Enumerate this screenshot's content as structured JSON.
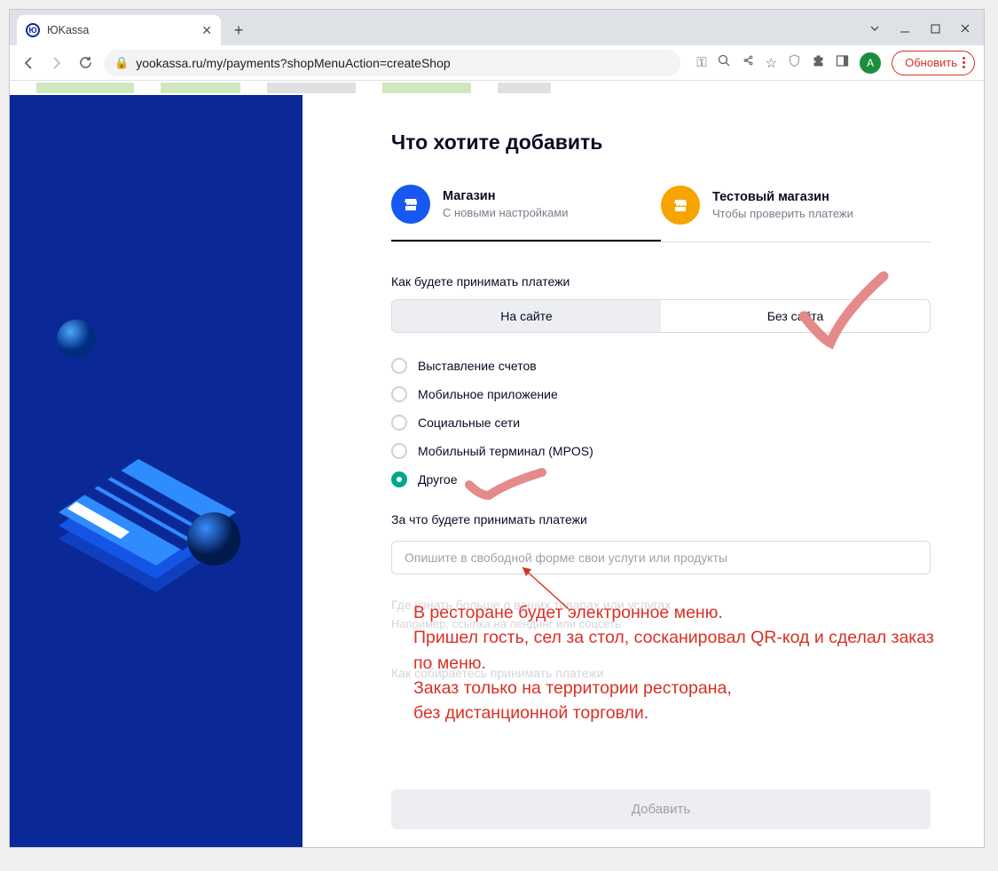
{
  "browser": {
    "tab_title": "ЮKassa",
    "url": "yookassa.ru/my/payments?shopMenuAction=createShop",
    "avatar_letter": "A",
    "update_label": "Обновить"
  },
  "page": {
    "heading": "Что хотите добавить",
    "type_tabs": [
      {
        "title": "Магазин",
        "sub": "С новыми настройками"
      },
      {
        "title": "Тестовый магазин",
        "sub": "Чтобы проверить платежи"
      }
    ],
    "how_label": "Как будете принимать платежи",
    "toggle": [
      "На сайте",
      "Без сайта"
    ],
    "radios": [
      "Выставление счетов",
      "Мобильное приложение",
      "Социальные сети",
      "Мобильный терминал (MPOS)",
      "Другое"
    ],
    "selected_radio": 4,
    "for_label": "За что будете принимать платежи",
    "for_placeholder": "Опишите в свободной форме свои услуги или продукты",
    "ghost1": "Где узнать больше о ваших товарах или услугах",
    "ghost2": "Например, ссылка на лендинг или соцсеть",
    "ghost3": "Как собираетесь принимать платежи",
    "submit": "Добавить"
  },
  "annotation": {
    "text": "В ресторане будет электронное меню.\nПришел гость, сел за стол, сосканировал QR-код и сделал заказ по меню.\nЗаказ только на территории ресторана,\nбез дистанционной торговли."
  }
}
